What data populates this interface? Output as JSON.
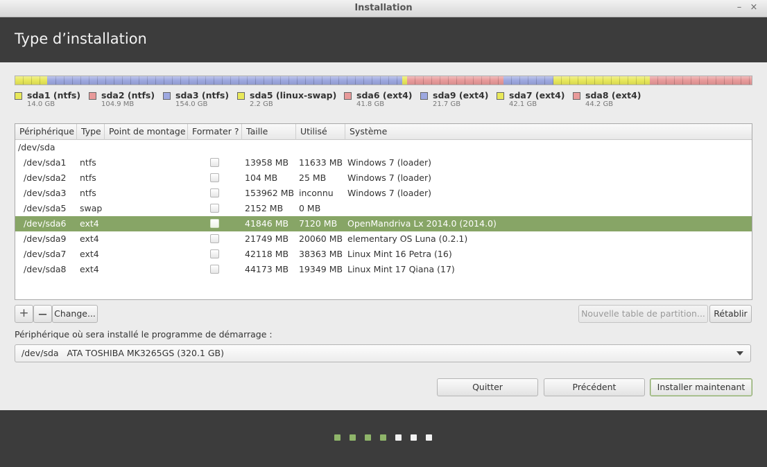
{
  "window": {
    "title": "Installation",
    "minimize": "–",
    "close": "×"
  },
  "header": {
    "title": "Type d’installation"
  },
  "disk_bar": {
    "segments": [
      {
        "color": "#e8e85a",
        "fraction": 0.0437
      },
      {
        "color": "#9da8e0",
        "fraction": 0.0003
      },
      {
        "color": "#9da8e0",
        "fraction": 0.4812
      },
      {
        "color": "#e8e85a",
        "fraction": 0.0069
      },
      {
        "color": "#e89a9a",
        "fraction": 0.1306
      },
      {
        "color": "#9da8e0",
        "fraction": 0.0678
      },
      {
        "color": "#e8e85a",
        "fraction": 0.1315
      },
      {
        "color": "#e89a9a",
        "fraction": 0.138
      }
    ]
  },
  "legend": [
    {
      "name": "sda1 (ntfs)",
      "size": "14.0 GB",
      "color": "#e8e85a"
    },
    {
      "name": "sda2 (ntfs)",
      "size": "104.9 MB",
      "color": "#e89a9a"
    },
    {
      "name": "sda3 (ntfs)",
      "size": "154.0 GB",
      "color": "#9da8e0"
    },
    {
      "name": "sda5 (linux-swap)",
      "size": "2.2 GB",
      "color": "#e8e85a"
    },
    {
      "name": "sda6 (ext4)",
      "size": "41.8 GB",
      "color": "#e89a9a"
    },
    {
      "name": "sda9 (ext4)",
      "size": "21.7 GB",
      "color": "#9da8e0"
    },
    {
      "name": "sda7 (ext4)",
      "size": "42.1 GB",
      "color": "#e8e85a"
    },
    {
      "name": "sda8 (ext4)",
      "size": "44.2 GB",
      "color": "#e89a9a"
    }
  ],
  "table": {
    "columns": [
      "Périphérique",
      "Type",
      "Point de montage",
      "Formater ?",
      "Taille",
      "Utilisé",
      "Système"
    ],
    "disk_row": "/dev/sda",
    "rows": [
      {
        "device": "/dev/sda1",
        "type": "ntfs",
        "mount": "",
        "format": false,
        "size": "13958 MB",
        "used": "11633 MB",
        "system": "Windows 7 (loader)"
      },
      {
        "device": "/dev/sda2",
        "type": "ntfs",
        "mount": "",
        "format": false,
        "size": "104 MB",
        "used": "25 MB",
        "system": "Windows 7 (loader)"
      },
      {
        "device": "/dev/sda3",
        "type": "ntfs",
        "mount": "",
        "format": false,
        "size": "153962 MB",
        "used": "inconnu",
        "system": "Windows 7 (loader)"
      },
      {
        "device": "/dev/sda5",
        "type": "swap",
        "mount": "",
        "format": false,
        "size": "2152 MB",
        "used": "0 MB",
        "system": ""
      },
      {
        "device": "/dev/sda6",
        "type": "ext4",
        "mount": "",
        "format": false,
        "size": "41846 MB",
        "used": "7120 MB",
        "system": "OpenMandriva Lx 2014.0 (2014.0)",
        "selected": true
      },
      {
        "device": "/dev/sda9",
        "type": "ext4",
        "mount": "",
        "format": false,
        "size": "21749 MB",
        "used": "20060 MB",
        "system": "elementary OS Luna (0.2.1)"
      },
      {
        "device": "/dev/sda7",
        "type": "ext4",
        "mount": "",
        "format": false,
        "size": "42118 MB",
        "used": "38363 MB",
        "system": "Linux Mint 16 Petra (16)"
      },
      {
        "device": "/dev/sda8",
        "type": "ext4",
        "mount": "",
        "format": false,
        "size": "44173 MB",
        "used": "19349 MB",
        "system": "Linux Mint 17 Qiana (17)"
      }
    ]
  },
  "toolbar": {
    "add": "+",
    "remove": "—",
    "change": "Change...",
    "new_table": "Nouvelle table de partition...",
    "revert": "Rétablir"
  },
  "bootloader": {
    "label": "Périphérique où sera installé le programme de démarrage :",
    "value": "/dev/sda   ATA TOSHIBA MK3265GS (320.1 GB)"
  },
  "actions": {
    "quit": "Quitter",
    "back": "Précédent",
    "install": "Installer maintenant"
  },
  "progress": {
    "total_steps": 7,
    "completed_steps": 4,
    "done_color": "#8fb56a",
    "todo_color": "#f2f2f2"
  }
}
